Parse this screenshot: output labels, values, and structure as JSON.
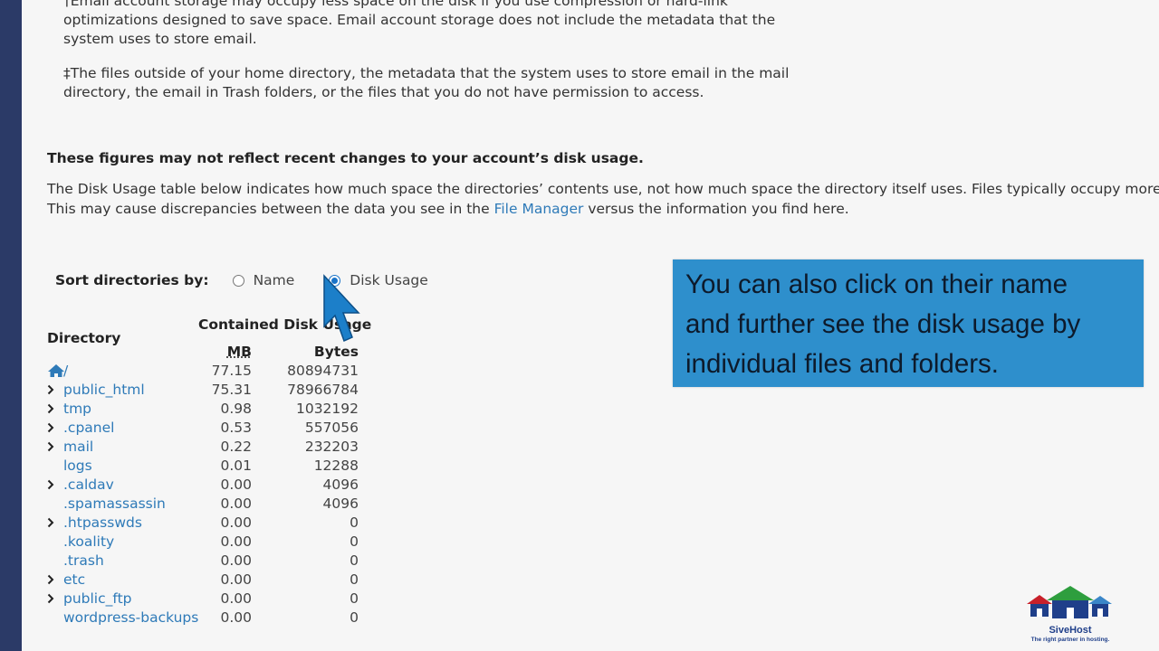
{
  "notes": {
    "email_note": "†Email account storage may occupy less space on the disk if you use compression or hard-link optimizations designed to save space. Email account storage does not include the metadata that the system uses to store email.",
    "other_note": "‡The files outside of your home directory, the metadata that the system uses to store email in the mail directory, the email in Trash folders, or the files that you do not have permission to access."
  },
  "headline": "These figures may not reflect recent changes to your account’s disk usage.",
  "description": {
    "line1": "The Disk Usage table below indicates how much space the directories’ contents use, not how much space the directory itself uses. Files typically occupy more disk",
    "line2_before": "This may cause discrepancies between the data you see in the ",
    "link": "File Manager",
    "line2_after": " versus the information you find here."
  },
  "sort": {
    "label": "Sort directories by:",
    "options": [
      {
        "label": "Name",
        "checked": false
      },
      {
        "label": "Disk Usage",
        "checked": true
      }
    ]
  },
  "table": {
    "contained_header": "Contained Disk Usage",
    "directory_header": "Directory",
    "mb_header": "MB",
    "bytes_header": "Bytes",
    "root": {
      "name": "/",
      "mb": "77.15",
      "bytes": "80894731"
    },
    "rows": [
      {
        "name": "public_html",
        "expandable": true,
        "mb": "75.31",
        "bytes": "78966784"
      },
      {
        "name": "tmp",
        "expandable": true,
        "mb": "0.98",
        "bytes": "1032192"
      },
      {
        "name": ".cpanel",
        "expandable": true,
        "mb": "0.53",
        "bytes": "557056"
      },
      {
        "name": "mail",
        "expandable": true,
        "mb": "0.22",
        "bytes": "232203"
      },
      {
        "name": "logs",
        "expandable": false,
        "mb": "0.01",
        "bytes": "12288"
      },
      {
        "name": ".caldav",
        "expandable": true,
        "mb": "0.00",
        "bytes": "4096"
      },
      {
        "name": ".spamassassin",
        "expandable": false,
        "mb": "0.00",
        "bytes": "4096"
      },
      {
        "name": ".htpasswds",
        "expandable": true,
        "mb": "0.00",
        "bytes": "0"
      },
      {
        "name": ".koality",
        "expandable": false,
        "mb": "0.00",
        "bytes": "0"
      },
      {
        "name": ".trash",
        "expandable": false,
        "mb": "0.00",
        "bytes": "0"
      },
      {
        "name": "etc",
        "expandable": true,
        "mb": "0.00",
        "bytes": "0"
      },
      {
        "name": "public_ftp",
        "expandable": true,
        "mb": "0.00",
        "bytes": "0"
      },
      {
        "name": "wordpress-backups",
        "expandable": false,
        "mb": "0.00",
        "bytes": "0"
      }
    ]
  },
  "callout": {
    "line1": "You can also click on their name",
    "line2": "and further see the disk usage by",
    "line3": "individual files and folders."
  },
  "logo": {
    "name": "SiveHost",
    "tagline": "The right partner in hosting."
  },
  "colors": {
    "link": "#2e7ab8",
    "callout_bg": "#2e8fcc",
    "radio_checked": "#1a73c8",
    "left_bar": "#2b3a67"
  }
}
